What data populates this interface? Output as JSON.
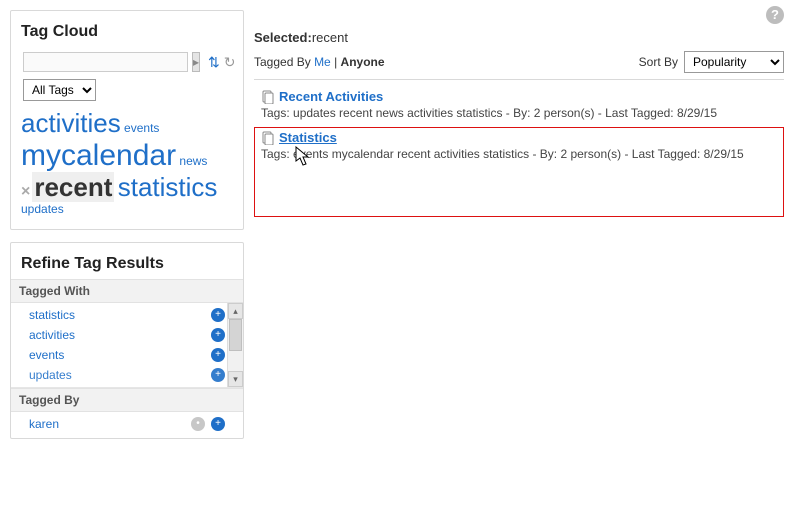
{
  "help_glyph": "?",
  "left": {
    "tag_cloud_title": "Tag Cloud",
    "go_glyph": "▸",
    "sort_glyph": "⇅",
    "refresh_glyph": "↻",
    "filter_select": {
      "selected": "All Tags"
    },
    "cloud": {
      "activities": "activities",
      "events": "events",
      "mycalendar": "mycalendar",
      "news": "news",
      "clear_glyph": "×",
      "recent": "recent",
      "statistics": "statistics",
      "updates": "updates"
    },
    "refine_title": "Refine Tag Results",
    "tagged_with_header": "Tagged With",
    "tagged_with": [
      {
        "label": "statistics"
      },
      {
        "label": "activities"
      },
      {
        "label": "events"
      },
      {
        "label": "updates"
      }
    ],
    "tagged_by_header": "Tagged By",
    "tagged_by": [
      {
        "label": "karen"
      }
    ],
    "scroll_up": "▴",
    "scroll_down": "▾",
    "plus_glyph": "+"
  },
  "right": {
    "selected_label": "Selected:",
    "selected_value": "recent",
    "tagged_by_label": "Tagged By",
    "me": "Me",
    "sep": "|",
    "anyone": "Anyone",
    "sortby_label": "Sort By",
    "sortby_select": {
      "selected": "Popularity"
    },
    "results": [
      {
        "title": "Recent Activities",
        "meta": "Tags: updates recent news activities statistics - By: 2 person(s) - Last Tagged: 8/29/15"
      },
      {
        "title": "Statistics",
        "meta": "Tags: events mycalendar recent activities statistics - By: 2 person(s) - Last Tagged: 8/29/15"
      }
    ]
  }
}
